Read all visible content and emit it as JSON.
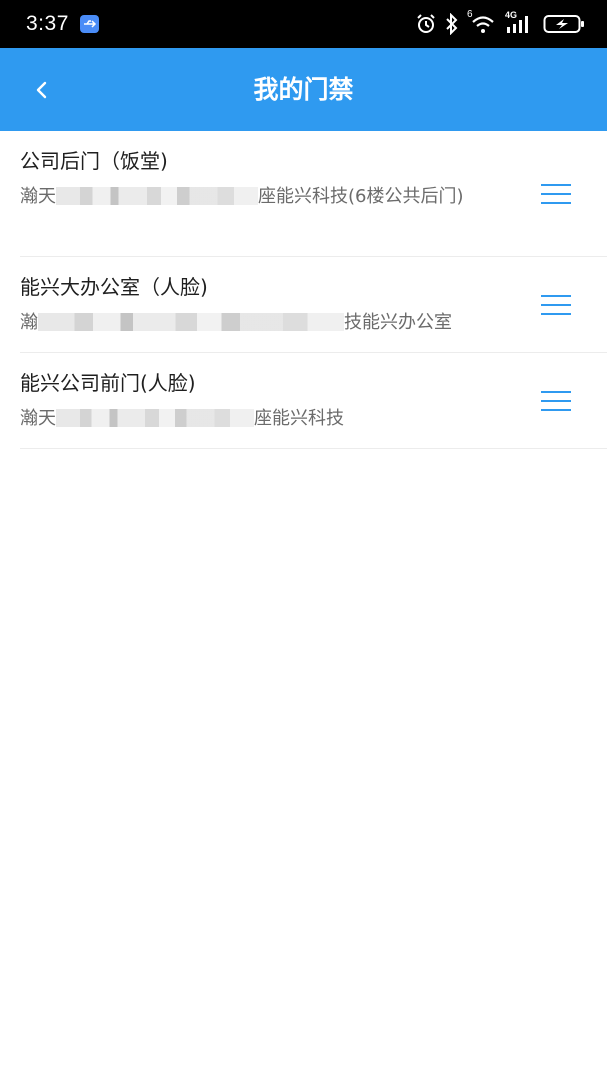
{
  "status_bar": {
    "time": "3:37",
    "network_label": "4G",
    "wifi_badge": "6"
  },
  "header": {
    "title": "我的门禁",
    "back_icon": "chevron-left-icon"
  },
  "doors": [
    {
      "name": "公司后门（饭堂)",
      "location_prefix": "瀚天",
      "location_suffix": "座能兴科技(6楼公共后门)"
    },
    {
      "name": "能兴大办公室（人脸)",
      "location_prefix": "瀚",
      "location_suffix": "技能兴办公室"
    },
    {
      "name": "能兴公司前门(人脸)",
      "location_prefix": "瀚天",
      "location_suffix": "座能兴科技"
    }
  ],
  "colors": {
    "accent": "#2f9af0",
    "status_bar": "#000000",
    "text_primary": "#1f1f1f",
    "text_secondary": "#6b6b6b"
  },
  "icons": {
    "row_action": "menu-lines-icon"
  }
}
